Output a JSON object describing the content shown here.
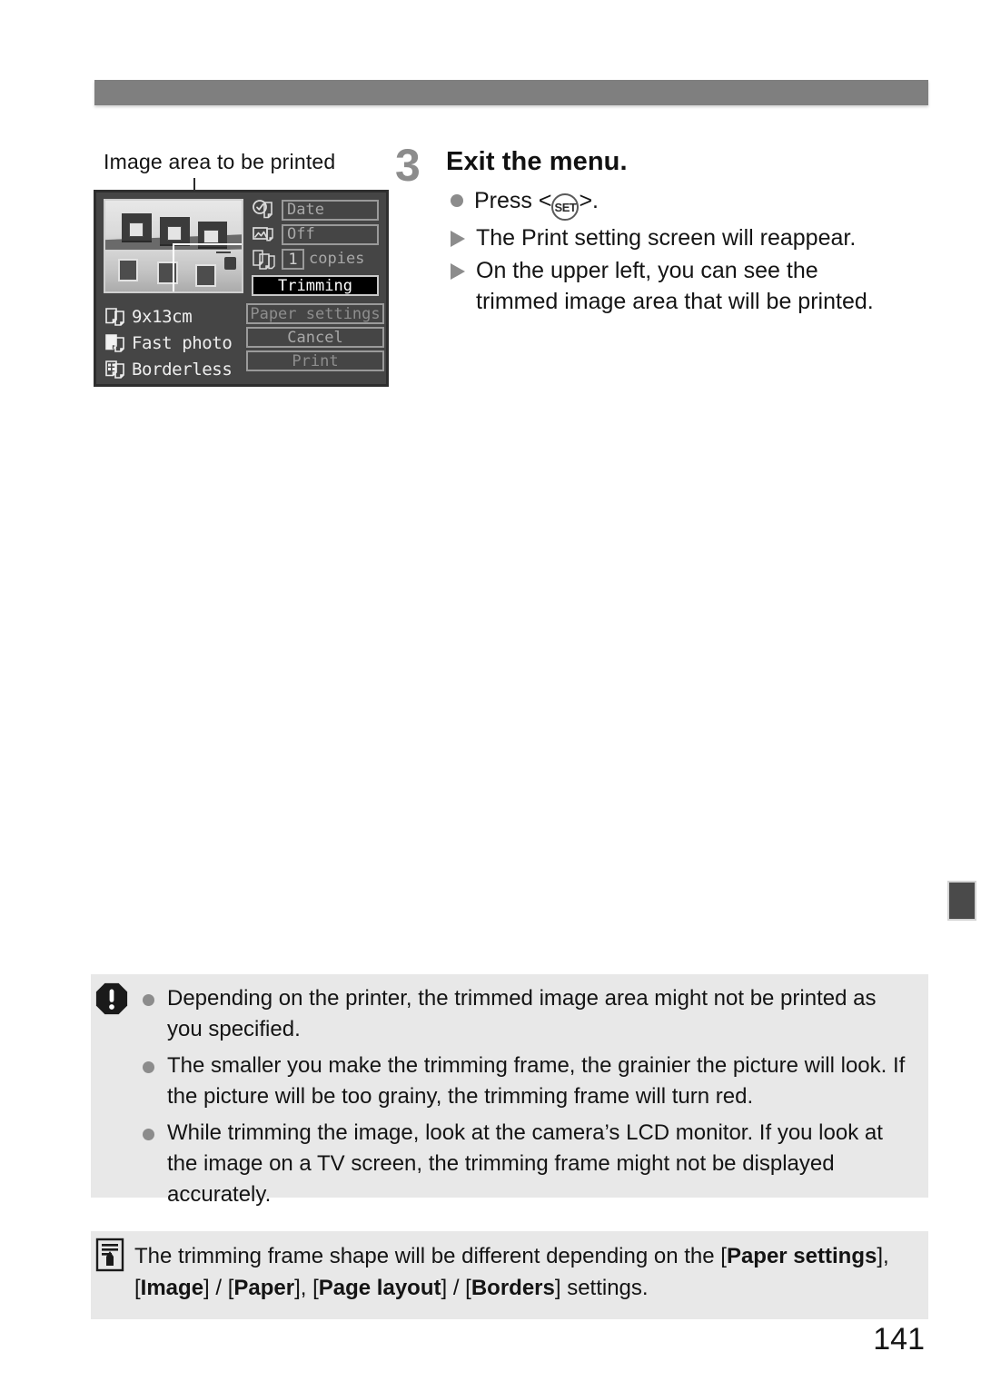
{
  "page": {
    "number": "141",
    "header_bar_color": "#7f7f7f",
    "edge_tab_color": "#4a4a4a"
  },
  "figure": {
    "caption": "Image area to be printed",
    "lcd": {
      "fields": [
        {
          "icon": "date-icon",
          "value": "Date"
        },
        {
          "icon": "image-effect-icon",
          "value": "Off"
        }
      ],
      "copies": {
        "icon": "copies-icon",
        "count": "1",
        "label": "copies"
      },
      "buttons": [
        {
          "label": "Trimming",
          "selected": true
        },
        {
          "label": "Paper settings",
          "selected": false
        },
        {
          "label": "Cancel",
          "selected": false
        },
        {
          "label": "Print",
          "selected": false
        }
      ],
      "paper_info": [
        {
          "icon": "paper-size-icon",
          "label": "9x13cm"
        },
        {
          "icon": "paper-type-icon",
          "label": "Fast photo"
        },
        {
          "icon": "page-layout-icon",
          "label": "Borderless"
        }
      ]
    }
  },
  "step": {
    "number": "3",
    "title": "Exit the menu.",
    "lines": [
      {
        "marker": "dot",
        "text_before": "Press <",
        "key": "SET",
        "text_after": ">."
      },
      {
        "marker": "triangle",
        "text": "The Print setting screen will reappear."
      },
      {
        "marker": "triangle",
        "text": "On the upper left, you can see the trimmed image area that will be printed."
      }
    ]
  },
  "caution": {
    "icon": "warning-icon",
    "items": [
      "Depending on the printer, the trimmed image area might not be printed as you specified.",
      "The smaller you make the trimming frame, the grainier the picture will look. If the picture will be too grainy, the trimming frame will turn red.",
      "While trimming the image, look at the camera’s LCD monitor. If you look at the image on a TV screen, the trimming frame might not be displayed accurately."
    ]
  },
  "memo": {
    "icon": "note-icon",
    "text_segments": [
      {
        "text": "The trimming frame shape will be different depending on the [",
        "bold": false
      },
      {
        "text": "Paper settings",
        "bold": true
      },
      {
        "text": "], [",
        "bold": false
      },
      {
        "text": "Image",
        "bold": true
      },
      {
        "text": "] / [",
        "bold": false
      },
      {
        "text": "Paper",
        "bold": true
      },
      {
        "text": "], [",
        "bold": false
      },
      {
        "text": "Page layout",
        "bold": true
      },
      {
        "text": "] / [",
        "bold": false
      },
      {
        "text": "Borders",
        "bold": true
      },
      {
        "text": "] settings.",
        "bold": false
      }
    ]
  }
}
